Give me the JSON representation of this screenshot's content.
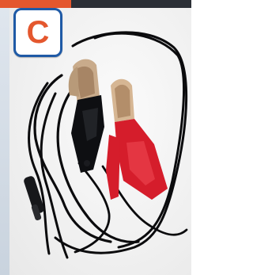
{
  "badge": {
    "letter": "C"
  },
  "colors": {
    "accent": "#e4572e",
    "badge_border": "#1f5aa6",
    "cable": "#0b0b0d",
    "clip_red": "#d51d2b",
    "clip_metal": "#c7a98a"
  },
  "photo": {
    "subject_icons": [
      "black-crocodile-clip",
      "red-crocodile-clip",
      "black-power-cable"
    ]
  }
}
